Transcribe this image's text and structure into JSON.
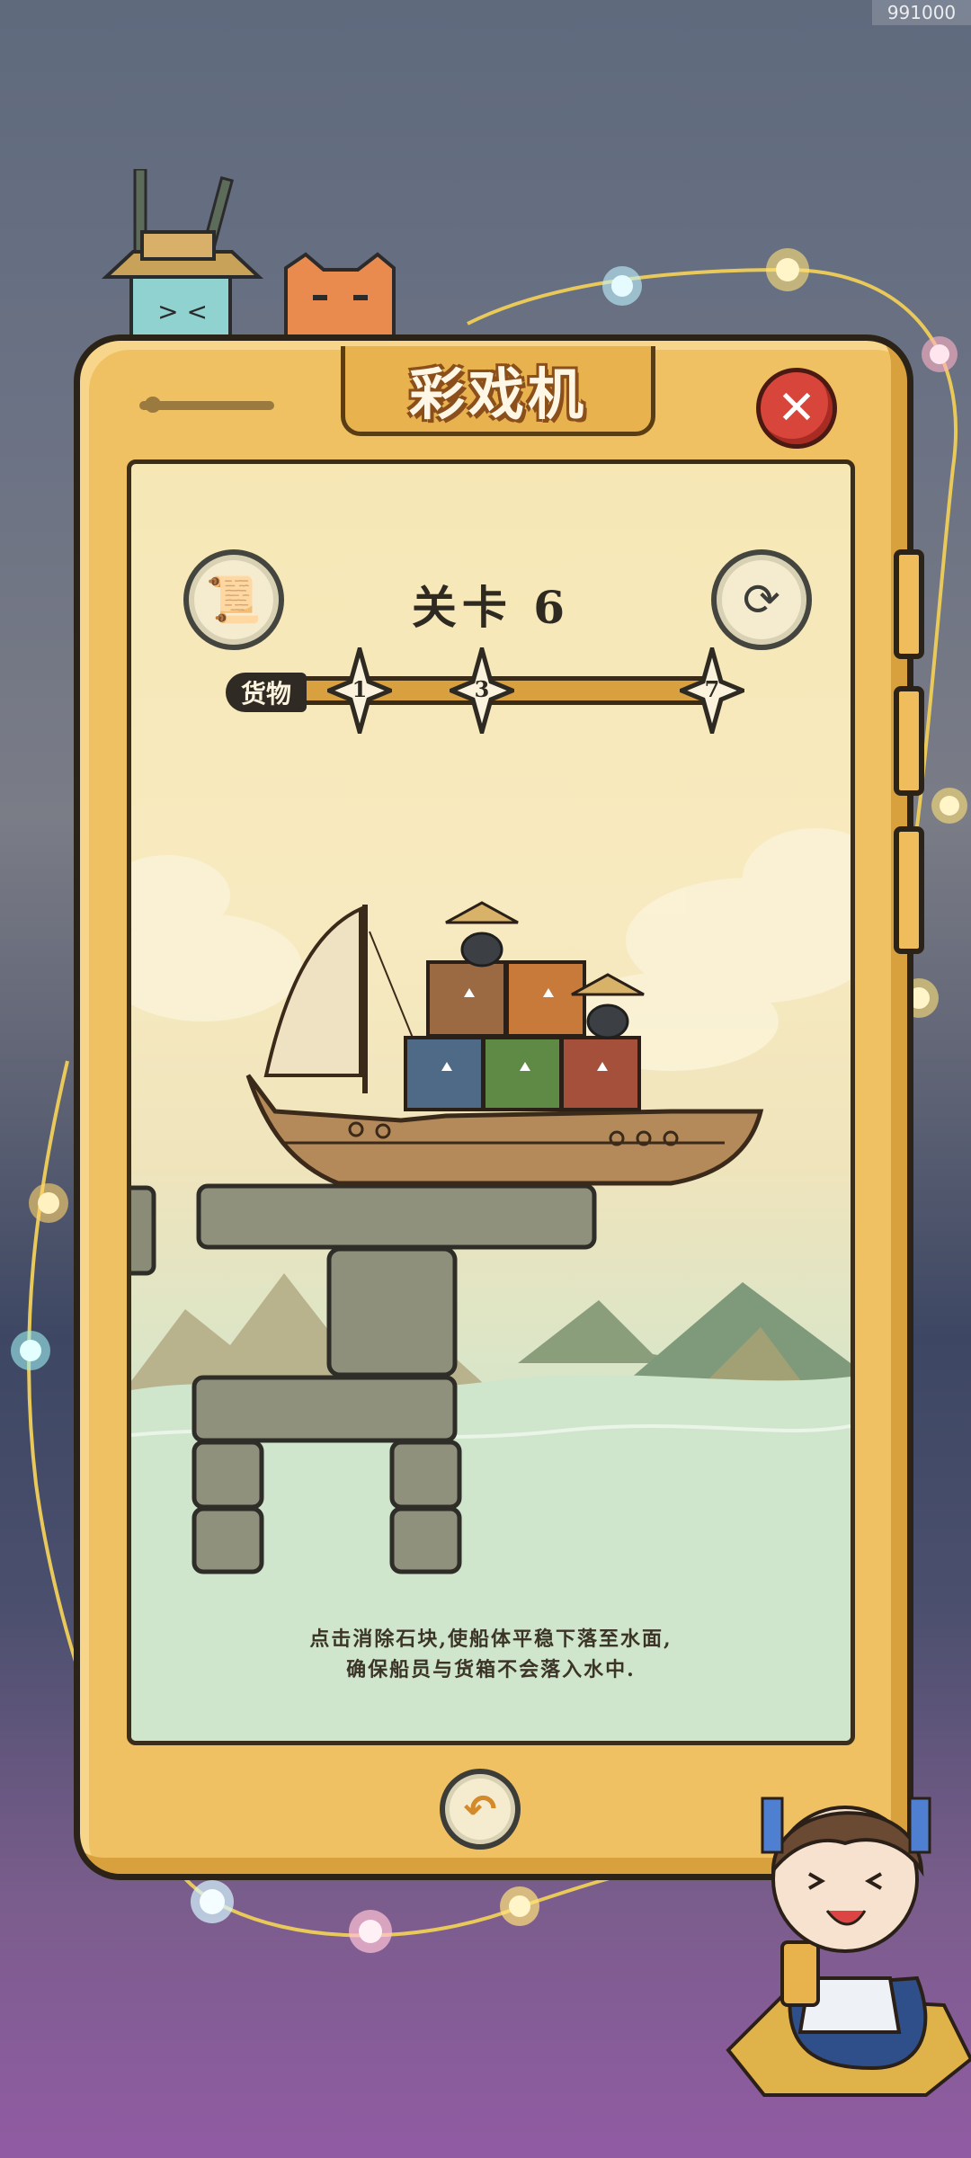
{
  "watermark": "991000",
  "window": {
    "title": "彩戏机",
    "close_glyph": "✕"
  },
  "level": {
    "label": "关卡 6"
  },
  "cargo": {
    "label": "货物",
    "progress": 0.0,
    "stars": [
      "1",
      "3",
      "7"
    ]
  },
  "toolbar": {
    "guide_icon": "scroll-icon",
    "restart_icon": "refresh-icon",
    "undo_icon": "undo-icon"
  },
  "hint": {
    "line1": "点击消除石块,使船体平稳下落至水面,",
    "line2": "确保船员与货箱不会落入水中."
  },
  "colors": {
    "phone": "#f0c162",
    "close": "#d8453a",
    "crate_blue": "#4f6a86",
    "crate_green": "#5f8a46",
    "crate_red": "#a4503a",
    "crate_orange": "#c87a3a"
  }
}
